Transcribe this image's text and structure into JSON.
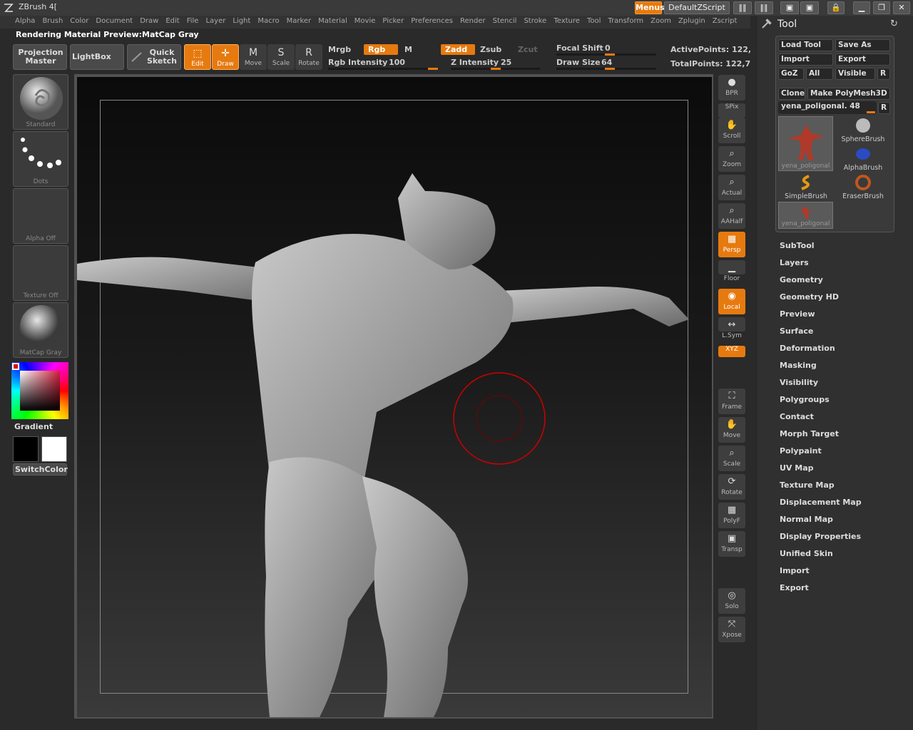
{
  "app": {
    "title": "ZBrush 4["
  },
  "titlebar": {
    "menus_label": "Menus",
    "script_label": "DefaultZScript"
  },
  "menubar": [
    "Alpha",
    "Brush",
    "Color",
    "Document",
    "Draw",
    "Edit",
    "File",
    "Layer",
    "Light",
    "Macro",
    "Marker",
    "Material",
    "Movie",
    "Picker",
    "Preferences",
    "Render",
    "Stencil",
    "Stroke",
    "Texture",
    "Tool",
    "Transform",
    "Zoom",
    "Zplugin",
    "Zscript"
  ],
  "status": "Rendering Material Preview:MatCap Gray",
  "toolbar": {
    "projection_master": "Projection Master",
    "lightbox": "LightBox",
    "quick_sketch": "Quick Sketch",
    "edit": "Edit",
    "draw": "Draw",
    "move": "Move",
    "scale": "Scale",
    "rotate": "Rotate",
    "move_glyph": "M",
    "scale_glyph": "S",
    "rotate_glyph": "R",
    "mrgb": "Mrgb",
    "rgb": "Rgb",
    "m": "M",
    "zadd": "Zadd",
    "zsub": "Zsub",
    "zcut": "Zcut",
    "rgb_intensity_label": "Rgb Intensity",
    "rgb_intensity": "100",
    "z_intensity_label": "Z Intensity",
    "z_intensity": "25",
    "focal_shift_label": "Focal Shift",
    "focal_shift": "0",
    "draw_size_label": "Draw Size",
    "draw_size": "64",
    "active_points": "ActivePoints: 122,",
    "total_points": "TotalPoints: 122,7"
  },
  "left_shelf": {
    "standard": "Standard",
    "dots": "Dots",
    "alpha": "Alpha  Off",
    "texture": "Texture  Off",
    "material": "MatCap  Gray",
    "gradient": "Gradient",
    "switch_color": "SwitchColor"
  },
  "right_shelf": [
    {
      "label": "BPR",
      "active": false
    },
    {
      "label": "SPix",
      "active": false
    },
    {
      "label": "Scroll",
      "active": false
    },
    {
      "label": "Zoom",
      "active": false
    },
    {
      "label": "Actual",
      "active": false
    },
    {
      "label": "AAHalf",
      "active": false
    },
    {
      "label": "Persp",
      "active": true
    },
    {
      "label": "Floor",
      "active": false
    },
    {
      "label": "Local",
      "active": true
    },
    {
      "label": "L.Sym",
      "active": false
    },
    {
      "label": "XYZ",
      "active": true
    },
    {
      "label": "Frame",
      "active": false
    },
    {
      "label": "Move",
      "active": false
    },
    {
      "label": "Scale",
      "active": false
    },
    {
      "label": "Rotate",
      "active": false
    },
    {
      "label": "PolyF",
      "active": false
    },
    {
      "label": "Transp",
      "active": false
    },
    {
      "label": "Solo",
      "active": false
    },
    {
      "label": "Xpose",
      "active": false
    }
  ],
  "tool_panel": {
    "title": "Tool",
    "load_tool": "Load Tool",
    "save_as": "Save As",
    "import": "Import",
    "export": "Export",
    "goz": "GoZ",
    "all": "All",
    "visible": "Visible",
    "r": "R",
    "clone": "Clone",
    "make_polymesh": "Make PolyMesh3D",
    "current_tool": "yena_poligonal. 48",
    "brushes": {
      "current": "yena_poligonal",
      "sphere": "SphereBrush",
      "alpha": "AlphaBrush",
      "simple": "SimpleBrush",
      "eraser": "EraserBrush",
      "recent": "yena_poligonal"
    },
    "subpalettes": [
      "SubTool",
      "Layers",
      "Geometry",
      "Geometry HD",
      "Preview",
      "Surface",
      "Deformation",
      "Masking",
      "Visibility",
      "Polygroups",
      "Contact",
      "Morph Target",
      "Polypaint",
      "UV Map",
      "Texture Map",
      "Displacement Map",
      "Normal Map",
      "Display Properties",
      "Unified Skin",
      "Import",
      "Export"
    ]
  }
}
